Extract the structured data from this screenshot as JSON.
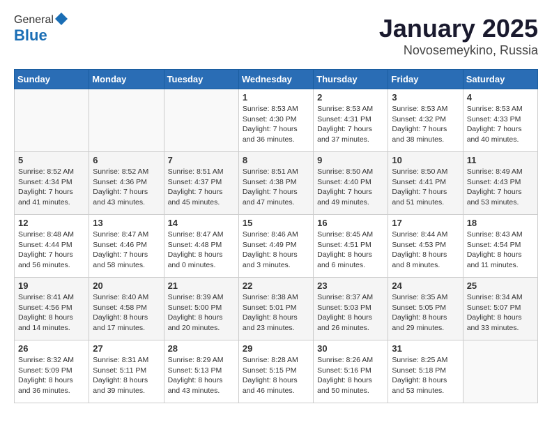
{
  "header": {
    "logo_general": "General",
    "logo_blue": "Blue",
    "month": "January 2025",
    "location": "Novosemeykino, Russia"
  },
  "weekdays": [
    "Sunday",
    "Monday",
    "Tuesday",
    "Wednesday",
    "Thursday",
    "Friday",
    "Saturday"
  ],
  "weeks": [
    [
      {
        "day": "",
        "info": ""
      },
      {
        "day": "",
        "info": ""
      },
      {
        "day": "",
        "info": ""
      },
      {
        "day": "1",
        "info": "Sunrise: 8:53 AM\nSunset: 4:30 PM\nDaylight: 7 hours\nand 36 minutes."
      },
      {
        "day": "2",
        "info": "Sunrise: 8:53 AM\nSunset: 4:31 PM\nDaylight: 7 hours\nand 37 minutes."
      },
      {
        "day": "3",
        "info": "Sunrise: 8:53 AM\nSunset: 4:32 PM\nDaylight: 7 hours\nand 38 minutes."
      },
      {
        "day": "4",
        "info": "Sunrise: 8:53 AM\nSunset: 4:33 PM\nDaylight: 7 hours\nand 40 minutes."
      }
    ],
    [
      {
        "day": "5",
        "info": "Sunrise: 8:52 AM\nSunset: 4:34 PM\nDaylight: 7 hours\nand 41 minutes."
      },
      {
        "day": "6",
        "info": "Sunrise: 8:52 AM\nSunset: 4:36 PM\nDaylight: 7 hours\nand 43 minutes."
      },
      {
        "day": "7",
        "info": "Sunrise: 8:51 AM\nSunset: 4:37 PM\nDaylight: 7 hours\nand 45 minutes."
      },
      {
        "day": "8",
        "info": "Sunrise: 8:51 AM\nSunset: 4:38 PM\nDaylight: 7 hours\nand 47 minutes."
      },
      {
        "day": "9",
        "info": "Sunrise: 8:50 AM\nSunset: 4:40 PM\nDaylight: 7 hours\nand 49 minutes."
      },
      {
        "day": "10",
        "info": "Sunrise: 8:50 AM\nSunset: 4:41 PM\nDaylight: 7 hours\nand 51 minutes."
      },
      {
        "day": "11",
        "info": "Sunrise: 8:49 AM\nSunset: 4:43 PM\nDaylight: 7 hours\nand 53 minutes."
      }
    ],
    [
      {
        "day": "12",
        "info": "Sunrise: 8:48 AM\nSunset: 4:44 PM\nDaylight: 7 hours\nand 56 minutes."
      },
      {
        "day": "13",
        "info": "Sunrise: 8:47 AM\nSunset: 4:46 PM\nDaylight: 7 hours\nand 58 minutes."
      },
      {
        "day": "14",
        "info": "Sunrise: 8:47 AM\nSunset: 4:48 PM\nDaylight: 8 hours\nand 0 minutes."
      },
      {
        "day": "15",
        "info": "Sunrise: 8:46 AM\nSunset: 4:49 PM\nDaylight: 8 hours\nand 3 minutes."
      },
      {
        "day": "16",
        "info": "Sunrise: 8:45 AM\nSunset: 4:51 PM\nDaylight: 8 hours\nand 6 minutes."
      },
      {
        "day": "17",
        "info": "Sunrise: 8:44 AM\nSunset: 4:53 PM\nDaylight: 8 hours\nand 8 minutes."
      },
      {
        "day": "18",
        "info": "Sunrise: 8:43 AM\nSunset: 4:54 PM\nDaylight: 8 hours\nand 11 minutes."
      }
    ],
    [
      {
        "day": "19",
        "info": "Sunrise: 8:41 AM\nSunset: 4:56 PM\nDaylight: 8 hours\nand 14 minutes."
      },
      {
        "day": "20",
        "info": "Sunrise: 8:40 AM\nSunset: 4:58 PM\nDaylight: 8 hours\nand 17 minutes."
      },
      {
        "day": "21",
        "info": "Sunrise: 8:39 AM\nSunset: 5:00 PM\nDaylight: 8 hours\nand 20 minutes."
      },
      {
        "day": "22",
        "info": "Sunrise: 8:38 AM\nSunset: 5:01 PM\nDaylight: 8 hours\nand 23 minutes."
      },
      {
        "day": "23",
        "info": "Sunrise: 8:37 AM\nSunset: 5:03 PM\nDaylight: 8 hours\nand 26 minutes."
      },
      {
        "day": "24",
        "info": "Sunrise: 8:35 AM\nSunset: 5:05 PM\nDaylight: 8 hours\nand 29 minutes."
      },
      {
        "day": "25",
        "info": "Sunrise: 8:34 AM\nSunset: 5:07 PM\nDaylight: 8 hours\nand 33 minutes."
      }
    ],
    [
      {
        "day": "26",
        "info": "Sunrise: 8:32 AM\nSunset: 5:09 PM\nDaylight: 8 hours\nand 36 minutes."
      },
      {
        "day": "27",
        "info": "Sunrise: 8:31 AM\nSunset: 5:11 PM\nDaylight: 8 hours\nand 39 minutes."
      },
      {
        "day": "28",
        "info": "Sunrise: 8:29 AM\nSunset: 5:13 PM\nDaylight: 8 hours\nand 43 minutes."
      },
      {
        "day": "29",
        "info": "Sunrise: 8:28 AM\nSunset: 5:15 PM\nDaylight: 8 hours\nand 46 minutes."
      },
      {
        "day": "30",
        "info": "Sunrise: 8:26 AM\nSunset: 5:16 PM\nDaylight: 8 hours\nand 50 minutes."
      },
      {
        "day": "31",
        "info": "Sunrise: 8:25 AM\nSunset: 5:18 PM\nDaylight: 8 hours\nand 53 minutes."
      },
      {
        "day": "",
        "info": ""
      }
    ]
  ]
}
